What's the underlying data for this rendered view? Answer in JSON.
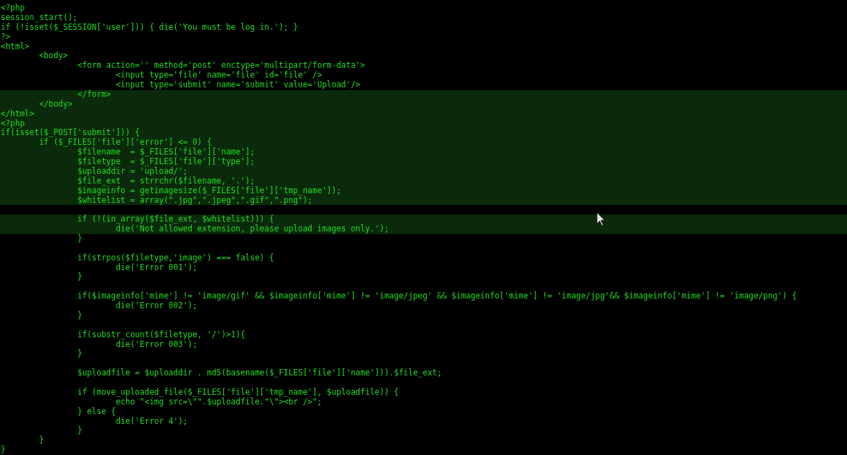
{
  "terminal": {
    "blocks": [
      [
        {
          "text": "<?php",
          "highlighted": false
        },
        {
          "text": "session_start();",
          "highlighted": false
        },
        {
          "text": "if (!isset($_SESSION['user'])) { die('You must be log in.'); }",
          "highlighted": false
        },
        {
          "text": "?>",
          "highlighted": false
        },
        {
          "text": "<html>",
          "highlighted": false
        },
        {
          "text": "        <body>",
          "highlighted": false
        },
        {
          "text": "                <form action='' method='post' enctype='multipart/form-data'>",
          "highlighted": false
        },
        {
          "text": "                        <input type='file' name='file' id='file' />",
          "highlighted": false
        },
        {
          "text": "                        <input type='submit' name='submit' value='Upload'/>",
          "highlighted": false
        },
        {
          "text": "                </form>",
          "highlighted": true
        },
        {
          "text": "        </body>",
          "highlighted": true
        },
        {
          "text": "</html>",
          "highlighted": true
        },
        {
          "text": "<?php",
          "highlighted": true
        },
        {
          "text": "if(isset($_POST['submit'])) {",
          "highlighted": true
        },
        {
          "text": "        if ($_FILES['file']['error'] <= 0) {",
          "highlighted": true
        },
        {
          "text": "                $filename  = $_FILES['file']['name'];",
          "highlighted": true
        },
        {
          "text": "                $filetype  = $_FILES['file']['type'];",
          "highlighted": true
        },
        {
          "text": "                $uploaddir = 'upload/';",
          "highlighted": true
        },
        {
          "text": "                $file_ext  = strrchr($filename, '.');",
          "highlighted": true
        },
        {
          "text": "                $imageinfo = getimagesize($_FILES['file']['tmp_name']);",
          "highlighted": true
        },
        {
          "text": "                $whitelist = array(\".jpg\",\".jpeg\",\".gif\",\".png\");",
          "highlighted": true
        }
      ],
      [
        {
          "text": "                if (!(in_array($file_ext, $whitelist))) {",
          "highlighted": true
        },
        {
          "text": "                        die('Not allowed extension, please upload images only.');",
          "highlighted": true
        },
        {
          "text": "                }",
          "highlighted": false
        }
      ],
      [
        {
          "text": "                if(strpos($filetype,'image') === false) {",
          "highlighted": false
        },
        {
          "text": "                        die('Error 001');",
          "highlighted": false
        },
        {
          "text": "                }",
          "highlighted": false
        }
      ],
      [
        {
          "text": "                if($imageinfo['mime'] != 'image/gif' && $imageinfo['mime'] != 'image/jpeg' && $imageinfo['mime'] != 'image/jpg'&& $imageinfo['mime'] != 'image/png') {",
          "highlighted": false
        },
        {
          "text": "                        die('Error 002');",
          "highlighted": false
        },
        {
          "text": "                }",
          "highlighted": false
        }
      ],
      [
        {
          "text": "                if(substr_count($filetype, '/')>1){",
          "highlighted": false
        },
        {
          "text": "                        die('Error 003');",
          "highlighted": false
        },
        {
          "text": "                }",
          "highlighted": false
        }
      ],
      [
        {
          "text": "                $uploadfile = $uploaddir . md5(basename($_FILES['file']['name'])).$file_ext;",
          "highlighted": false
        }
      ],
      [
        {
          "text": "                if (move_uploaded_file($_FILES['file']['tmp_name'], $uploadfile)) {",
          "highlighted": false
        },
        {
          "text": "                        echo \"<img src=\\\"\".$uploadfile.\"\\\"><br />\";",
          "highlighted": false
        },
        {
          "text": "                } else {",
          "highlighted": false
        },
        {
          "text": "                        die('Error 4');",
          "highlighted": false
        },
        {
          "text": "                }",
          "highlighted": false
        },
        {
          "text": "        }",
          "highlighted": false
        },
        {
          "text": "}",
          "highlighted": false
        }
      ]
    ]
  }
}
